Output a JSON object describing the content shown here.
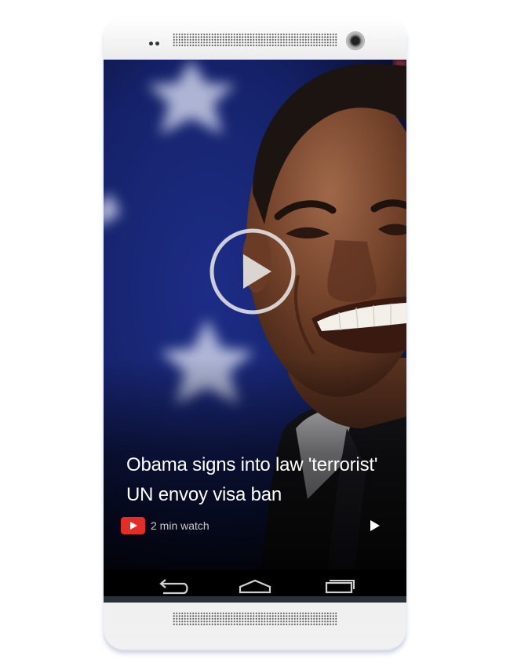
{
  "headline": {
    "line1": "Obama signs into law 'terrorist'",
    "line2": "UN envoy visa ban"
  },
  "meta": {
    "source_icon": "youtube-icon",
    "duration_text": "2 min watch"
  },
  "controls": {
    "big_play_icon": "play-circle-icon",
    "small_play_icon": "play-icon"
  },
  "navbar": {
    "back_icon": "back-icon",
    "home_icon": "home-icon",
    "recents_icon": "recents-icon"
  },
  "colors": {
    "accent_red": "#e52d27",
    "flag_blue": "#1a2a78",
    "screen_black": "#000000"
  }
}
